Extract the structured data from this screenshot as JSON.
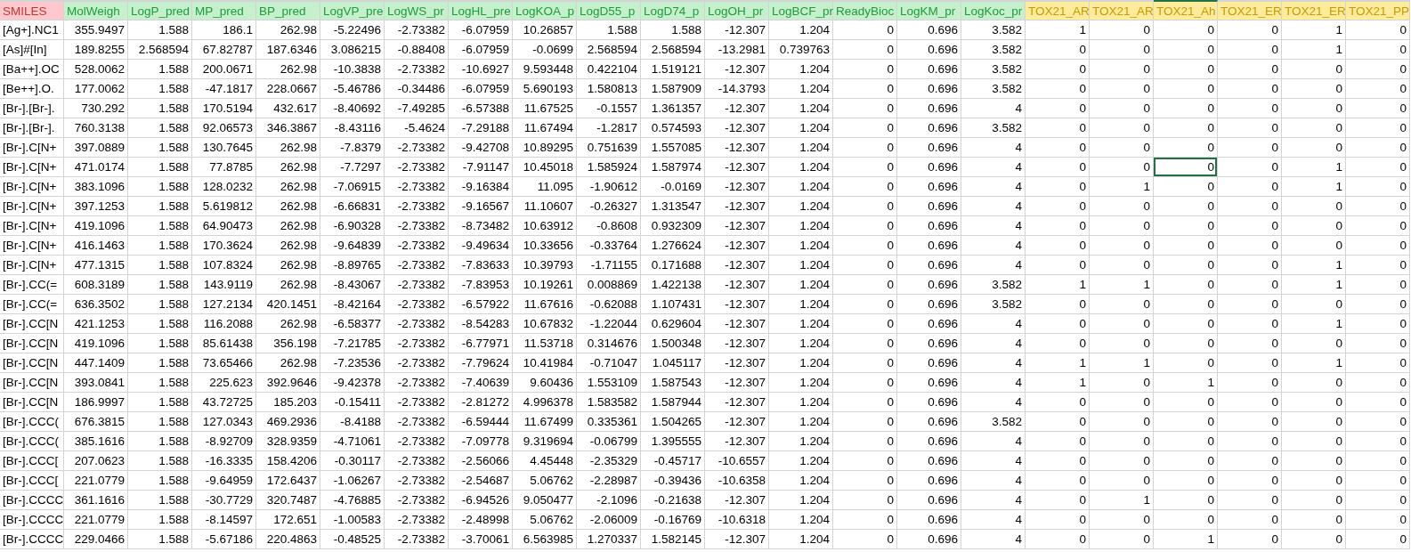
{
  "columns": [
    {
      "label": "SMILES",
      "kind": "id",
      "selected": false
    },
    {
      "label": "MolWeigh",
      "kind": "property",
      "selected": false
    },
    {
      "label": "LogP_pred",
      "kind": "property",
      "selected": false
    },
    {
      "label": "MP_pred",
      "kind": "property",
      "selected": false
    },
    {
      "label": "BP_pred",
      "kind": "property",
      "selected": false
    },
    {
      "label": "LogVP_pre",
      "kind": "property",
      "selected": false
    },
    {
      "label": "LogWS_pr",
      "kind": "property",
      "selected": false
    },
    {
      "label": "LogHL_pre",
      "kind": "property",
      "selected": false
    },
    {
      "label": "LogKOA_p",
      "kind": "property",
      "selected": false
    },
    {
      "label": "LogD55_p",
      "kind": "property",
      "selected": false
    },
    {
      "label": "LogD74_p",
      "kind": "property",
      "selected": false
    },
    {
      "label": "LogOH_pr",
      "kind": "property",
      "selected": false
    },
    {
      "label": "LogBCF_pr",
      "kind": "property",
      "selected": false
    },
    {
      "label": "ReadyBioc",
      "kind": "property",
      "selected": false
    },
    {
      "label": "LogKM_pr",
      "kind": "property",
      "selected": false
    },
    {
      "label": "LogKoc_pr",
      "kind": "property",
      "selected": false
    },
    {
      "label": "TOX21_AR",
      "kind": "tox",
      "selected": false
    },
    {
      "label": "TOX21_AR",
      "kind": "tox",
      "selected": false
    },
    {
      "label": "TOX21_Ah",
      "kind": "tox",
      "selected": true
    },
    {
      "label": "TOX21_ER",
      "kind": "tox",
      "selected": false
    },
    {
      "label": "TOX21_ER",
      "kind": "tox",
      "selected": false
    },
    {
      "label": "TOX21_PP",
      "kind": "tox",
      "selected": false
    }
  ],
  "rows": [
    {
      "values": [
        "[Ag+].NC1",
        "355.9497",
        "1.588",
        "186.1",
        "262.98",
        "-5.22496",
        "-2.73382",
        "-6.07959",
        "10.26857",
        "1.588",
        "1.588",
        "-12.307",
        "1.204",
        "0",
        "0.696",
        "3.582"
      ],
      "tox": [
        {
          "value": "1",
          "selected": false
        },
        {
          "value": "0",
          "selected": false
        },
        {
          "value": "0",
          "selected": false
        },
        {
          "value": "0",
          "selected": false
        },
        {
          "value": "1",
          "selected": false
        },
        {
          "value": "0",
          "selected": false
        }
      ]
    },
    {
      "values": [
        "[As]#[In]",
        "189.8255",
        "2.568594",
        "67.82787",
        "187.6346",
        "3.086215",
        "-0.88408",
        "-6.07959",
        "-0.0699",
        "2.568594",
        "2.568594",
        "-13.2981",
        "0.739763",
        "0",
        "0.696",
        "3.582"
      ],
      "tox": [
        {
          "value": "0",
          "selected": false
        },
        {
          "value": "0",
          "selected": false
        },
        {
          "value": "0",
          "selected": false
        },
        {
          "value": "0",
          "selected": false
        },
        {
          "value": "1",
          "selected": false
        },
        {
          "value": "0",
          "selected": false
        }
      ]
    },
    {
      "values": [
        "[Ba++].OC",
        "528.0062",
        "1.588",
        "200.0671",
        "262.98",
        "-10.3838",
        "-2.73382",
        "-10.6927",
        "9.593448",
        "0.422104",
        "1.519121",
        "-12.307",
        "1.204",
        "0",
        "0.696",
        "3.582"
      ],
      "tox": [
        {
          "value": "0",
          "selected": false
        },
        {
          "value": "0",
          "selected": false
        },
        {
          "value": "0",
          "selected": false
        },
        {
          "value": "0",
          "selected": false
        },
        {
          "value": "0",
          "selected": false
        },
        {
          "value": "0",
          "selected": false
        }
      ]
    },
    {
      "values": [
        "[Be++].O.",
        "177.0062",
        "1.588",
        "-47.1817",
        "228.0667",
        "-5.46786",
        "-0.34486",
        "-6.07959",
        "5.690193",
        "1.580813",
        "1.587909",
        "-14.3793",
        "1.204",
        "0",
        "0.696",
        "3.582"
      ],
      "tox": [
        {
          "value": "0",
          "selected": false
        },
        {
          "value": "0",
          "selected": false
        },
        {
          "value": "0",
          "selected": false
        },
        {
          "value": "0",
          "selected": false
        },
        {
          "value": "0",
          "selected": false
        },
        {
          "value": "0",
          "selected": false
        }
      ]
    },
    {
      "values": [
        "[Br-].[Br-].",
        "730.292",
        "1.588",
        "170.5194",
        "432.617",
        "-8.40692",
        "-7.49285",
        "-6.57388",
        "11.67525",
        "-0.1557",
        "1.361357",
        "-12.307",
        "1.204",
        "0",
        "0.696",
        "4"
      ],
      "tox": [
        {
          "value": "0",
          "selected": false
        },
        {
          "value": "0",
          "selected": false
        },
        {
          "value": "0",
          "selected": false
        },
        {
          "value": "0",
          "selected": false
        },
        {
          "value": "0",
          "selected": false
        },
        {
          "value": "0",
          "selected": false
        }
      ]
    },
    {
      "values": [
        "[Br-].[Br-].",
        "760.3138",
        "1.588",
        "92.06573",
        "346.3867",
        "-8.43116",
        "-5.4624",
        "-7.29188",
        "11.67494",
        "-1.2817",
        "0.574593",
        "-12.307",
        "1.204",
        "0",
        "0.696",
        "3.582"
      ],
      "tox": [
        {
          "value": "0",
          "selected": false
        },
        {
          "value": "0",
          "selected": false
        },
        {
          "value": "0",
          "selected": false
        },
        {
          "value": "0",
          "selected": false
        },
        {
          "value": "0",
          "selected": false
        },
        {
          "value": "0",
          "selected": false
        }
      ]
    },
    {
      "values": [
        "[Br-].C[N+",
        "397.0889",
        "1.588",
        "130.7645",
        "262.98",
        "-7.8379",
        "-2.73382",
        "-9.42708",
        "10.89295",
        "0.751639",
        "1.557085",
        "-12.307",
        "1.204",
        "0",
        "0.696",
        "4"
      ],
      "tox": [
        {
          "value": "0",
          "selected": false
        },
        {
          "value": "0",
          "selected": false
        },
        {
          "value": "0",
          "selected": false
        },
        {
          "value": "0",
          "selected": false
        },
        {
          "value": "0",
          "selected": false
        },
        {
          "value": "0",
          "selected": false
        }
      ]
    },
    {
      "values": [
        "[Br-].C[N+",
        "471.0174",
        "1.588",
        "77.8785",
        "262.98",
        "-7.7297",
        "-2.73382",
        "-7.91147",
        "10.45018",
        "1.585924",
        "1.587974",
        "-12.307",
        "1.204",
        "0",
        "0.696",
        "4"
      ],
      "tox": [
        {
          "value": "0",
          "selected": false
        },
        {
          "value": "0",
          "selected": false
        },
        {
          "value": "0",
          "selected": true
        },
        {
          "value": "0",
          "selected": false
        },
        {
          "value": "1",
          "selected": false
        },
        {
          "value": "0",
          "selected": false
        }
      ]
    },
    {
      "values": [
        "[Br-].C[N+",
        "383.1096",
        "1.588",
        "128.0232",
        "262.98",
        "-7.06915",
        "-2.73382",
        "-9.16384",
        "11.095",
        "-1.90612",
        "-0.0169",
        "-12.307",
        "1.204",
        "0",
        "0.696",
        "4"
      ],
      "tox": [
        {
          "value": "0",
          "selected": false
        },
        {
          "value": "1",
          "selected": false
        },
        {
          "value": "0",
          "selected": false
        },
        {
          "value": "0",
          "selected": false
        },
        {
          "value": "1",
          "selected": false
        },
        {
          "value": "0",
          "selected": false
        }
      ]
    },
    {
      "values": [
        "[Br-].C[N+",
        "397.1253",
        "1.588",
        "5.619812",
        "262.98",
        "-6.66831",
        "-2.73382",
        "-9.16567",
        "11.10607",
        "-0.26327",
        "1.313547",
        "-12.307",
        "1.204",
        "0",
        "0.696",
        "4"
      ],
      "tox": [
        {
          "value": "0",
          "selected": false
        },
        {
          "value": "0",
          "selected": false
        },
        {
          "value": "0",
          "selected": false
        },
        {
          "value": "0",
          "selected": false
        },
        {
          "value": "0",
          "selected": false
        },
        {
          "value": "0",
          "selected": false
        }
      ]
    },
    {
      "values": [
        "[Br-].C[N+",
        "419.1096",
        "1.588",
        "64.90473",
        "262.98",
        "-6.90328",
        "-2.73382",
        "-8.73482",
        "10.63912",
        "-0.8608",
        "0.932309",
        "-12.307",
        "1.204",
        "0",
        "0.696",
        "4"
      ],
      "tox": [
        {
          "value": "0",
          "selected": false
        },
        {
          "value": "0",
          "selected": false
        },
        {
          "value": "0",
          "selected": false
        },
        {
          "value": "0",
          "selected": false
        },
        {
          "value": "0",
          "selected": false
        },
        {
          "value": "0",
          "selected": false
        }
      ]
    },
    {
      "values": [
        "[Br-].C[N+",
        "416.1463",
        "1.588",
        "170.3624",
        "262.98",
        "-9.64839",
        "-2.73382",
        "-9.49634",
        "10.33656",
        "-0.33764",
        "1.276624",
        "-12.307",
        "1.204",
        "0",
        "0.696",
        "4"
      ],
      "tox": [
        {
          "value": "0",
          "selected": false
        },
        {
          "value": "0",
          "selected": false
        },
        {
          "value": "0",
          "selected": false
        },
        {
          "value": "0",
          "selected": false
        },
        {
          "value": "0",
          "selected": false
        },
        {
          "value": "0",
          "selected": false
        }
      ]
    },
    {
      "values": [
        "[Br-].C[N+",
        "477.1315",
        "1.588",
        "107.8324",
        "262.98",
        "-8.89765",
        "-2.73382",
        "-7.83633",
        "10.39793",
        "-1.71155",
        "0.171688",
        "-12.307",
        "1.204",
        "0",
        "0.696",
        "4"
      ],
      "tox": [
        {
          "value": "0",
          "selected": false
        },
        {
          "value": "0",
          "selected": false
        },
        {
          "value": "0",
          "selected": false
        },
        {
          "value": "0",
          "selected": false
        },
        {
          "value": "1",
          "selected": false
        },
        {
          "value": "0",
          "selected": false
        }
      ]
    },
    {
      "values": [
        "[Br-].CC(=",
        "608.3189",
        "1.588",
        "143.9119",
        "262.98",
        "-8.43067",
        "-2.73382",
        "-7.83953",
        "10.19261",
        "0.008869",
        "1.422138",
        "-12.307",
        "1.204",
        "0",
        "0.696",
        "3.582"
      ],
      "tox": [
        {
          "value": "1",
          "selected": false
        },
        {
          "value": "1",
          "selected": false
        },
        {
          "value": "0",
          "selected": false
        },
        {
          "value": "0",
          "selected": false
        },
        {
          "value": "1",
          "selected": false
        },
        {
          "value": "0",
          "selected": false
        }
      ]
    },
    {
      "values": [
        "[Br-].CC(=",
        "636.3502",
        "1.588",
        "127.2134",
        "420.1451",
        "-8.42164",
        "-2.73382",
        "-6.57922",
        "11.67616",
        "-0.62088",
        "1.107431",
        "-12.307",
        "1.204",
        "0",
        "0.696",
        "3.582"
      ],
      "tox": [
        {
          "value": "0",
          "selected": false
        },
        {
          "value": "0",
          "selected": false
        },
        {
          "value": "0",
          "selected": false
        },
        {
          "value": "0",
          "selected": false
        },
        {
          "value": "0",
          "selected": false
        },
        {
          "value": "0",
          "selected": false
        }
      ]
    },
    {
      "values": [
        "[Br-].CC[N",
        "421.1253",
        "1.588",
        "116.2088",
        "262.98",
        "-6.58377",
        "-2.73382",
        "-8.54283",
        "10.67832",
        "-1.22044",
        "0.629604",
        "-12.307",
        "1.204",
        "0",
        "0.696",
        "4"
      ],
      "tox": [
        {
          "value": "0",
          "selected": false
        },
        {
          "value": "0",
          "selected": false
        },
        {
          "value": "0",
          "selected": false
        },
        {
          "value": "0",
          "selected": false
        },
        {
          "value": "1",
          "selected": false
        },
        {
          "value": "0",
          "selected": false
        }
      ]
    },
    {
      "values": [
        "[Br-].CC[N",
        "419.1096",
        "1.588",
        "85.61438",
        "356.198",
        "-7.21785",
        "-2.73382",
        "-6.77971",
        "11.53718",
        "0.314676",
        "1.500348",
        "-12.307",
        "1.204",
        "0",
        "0.696",
        "4"
      ],
      "tox": [
        {
          "value": "0",
          "selected": false
        },
        {
          "value": "0",
          "selected": false
        },
        {
          "value": "0",
          "selected": false
        },
        {
          "value": "0",
          "selected": false
        },
        {
          "value": "0",
          "selected": false
        },
        {
          "value": "0",
          "selected": false
        }
      ]
    },
    {
      "values": [
        "[Br-].CC[N",
        "447.1409",
        "1.588",
        "73.65466",
        "262.98",
        "-7.23536",
        "-2.73382",
        "-7.79624",
        "10.41984",
        "-0.71047",
        "1.045117",
        "-12.307",
        "1.204",
        "0",
        "0.696",
        "4"
      ],
      "tox": [
        {
          "value": "1",
          "selected": false
        },
        {
          "value": "1",
          "selected": false
        },
        {
          "value": "0",
          "selected": false
        },
        {
          "value": "0",
          "selected": false
        },
        {
          "value": "1",
          "selected": false
        },
        {
          "value": "0",
          "selected": false
        }
      ]
    },
    {
      "values": [
        "[Br-].CC[N",
        "393.0841",
        "1.588",
        "225.623",
        "392.9646",
        "-9.42378",
        "-2.73382",
        "-7.40639",
        "9.60436",
        "1.553109",
        "1.587543",
        "-12.307",
        "1.204",
        "0",
        "0.696",
        "4"
      ],
      "tox": [
        {
          "value": "1",
          "selected": false
        },
        {
          "value": "0",
          "selected": false
        },
        {
          "value": "1",
          "selected": false
        },
        {
          "value": "0",
          "selected": false
        },
        {
          "value": "0",
          "selected": false
        },
        {
          "value": "0",
          "selected": false
        }
      ]
    },
    {
      "values": [
        "[Br-].CC[N",
        "186.9997",
        "1.588",
        "43.72725",
        "185.203",
        "-0.15411",
        "-2.73382",
        "-2.81272",
        "4.996378",
        "1.583582",
        "1.587944",
        "-12.307",
        "1.204",
        "0",
        "0.696",
        "4"
      ],
      "tox": [
        {
          "value": "0",
          "selected": false
        },
        {
          "value": "0",
          "selected": false
        },
        {
          "value": "0",
          "selected": false
        },
        {
          "value": "0",
          "selected": false
        },
        {
          "value": "0",
          "selected": false
        },
        {
          "value": "0",
          "selected": false
        }
      ]
    },
    {
      "values": [
        "[Br-].CCC(",
        "676.3815",
        "1.588",
        "127.0343",
        "469.2936",
        "-8.4188",
        "-2.73382",
        "-6.59444",
        "11.67499",
        "0.335361",
        "1.504265",
        "-12.307",
        "1.204",
        "0",
        "0.696",
        "3.582"
      ],
      "tox": [
        {
          "value": "0",
          "selected": false
        },
        {
          "value": "0",
          "selected": false
        },
        {
          "value": "0",
          "selected": false
        },
        {
          "value": "0",
          "selected": false
        },
        {
          "value": "0",
          "selected": false
        },
        {
          "value": "0",
          "selected": false
        }
      ]
    },
    {
      "values": [
        "[Br-].CCC(",
        "385.1616",
        "1.588",
        "-8.92709",
        "328.9359",
        "-4.71061",
        "-2.73382",
        "-7.09778",
        "9.319694",
        "-0.06799",
        "1.395555",
        "-12.307",
        "1.204",
        "0",
        "0.696",
        "4"
      ],
      "tox": [
        {
          "value": "0",
          "selected": false
        },
        {
          "value": "0",
          "selected": false
        },
        {
          "value": "0",
          "selected": false
        },
        {
          "value": "0",
          "selected": false
        },
        {
          "value": "0",
          "selected": false
        },
        {
          "value": "0",
          "selected": false
        }
      ]
    },
    {
      "values": [
        "[Br-].CCC[",
        "207.0623",
        "1.588",
        "-16.3335",
        "158.4206",
        "-0.30117",
        "-2.73382",
        "-2.56066",
        "4.45448",
        "-2.35329",
        "-0.45717",
        "-10.6557",
        "1.204",
        "0",
        "0.696",
        "4"
      ],
      "tox": [
        {
          "value": "0",
          "selected": false
        },
        {
          "value": "0",
          "selected": false
        },
        {
          "value": "0",
          "selected": false
        },
        {
          "value": "0",
          "selected": false
        },
        {
          "value": "0",
          "selected": false
        },
        {
          "value": "0",
          "selected": false
        }
      ]
    },
    {
      "values": [
        "[Br-].CCC[",
        "221.0779",
        "1.588",
        "-9.64959",
        "172.6437",
        "-1.06267",
        "-2.73382",
        "-2.54687",
        "5.06762",
        "-2.28987",
        "-0.39436",
        "-10.6358",
        "1.204",
        "0",
        "0.696",
        "4"
      ],
      "tox": [
        {
          "value": "0",
          "selected": false
        },
        {
          "value": "0",
          "selected": false
        },
        {
          "value": "0",
          "selected": false
        },
        {
          "value": "0",
          "selected": false
        },
        {
          "value": "0",
          "selected": false
        },
        {
          "value": "0",
          "selected": false
        }
      ]
    },
    {
      "values": [
        "[Br-].CCCC",
        "361.1616",
        "1.588",
        "-30.7729",
        "320.7487",
        "-4.76885",
        "-2.73382",
        "-6.94526",
        "9.050477",
        "-2.1096",
        "-0.21638",
        "-12.307",
        "1.204",
        "0",
        "0.696",
        "4"
      ],
      "tox": [
        {
          "value": "0",
          "selected": false
        },
        {
          "value": "1",
          "selected": false
        },
        {
          "value": "0",
          "selected": false
        },
        {
          "value": "0",
          "selected": false
        },
        {
          "value": "0",
          "selected": false
        },
        {
          "value": "0",
          "selected": false
        }
      ]
    },
    {
      "values": [
        "[Br-].CCCC",
        "221.0779",
        "1.588",
        "-8.14597",
        "172.651",
        "-1.00583",
        "-2.73382",
        "-2.48998",
        "5.06762",
        "-2.06009",
        "-0.16769",
        "-10.6318",
        "1.204",
        "0",
        "0.696",
        "4"
      ],
      "tox": [
        {
          "value": "0",
          "selected": false
        },
        {
          "value": "0",
          "selected": false
        },
        {
          "value": "0",
          "selected": false
        },
        {
          "value": "0",
          "selected": false
        },
        {
          "value": "0",
          "selected": false
        },
        {
          "value": "0",
          "selected": false
        }
      ]
    },
    {
      "values": [
        "[Br-].CCCC",
        "229.0466",
        "1.588",
        "-5.67186",
        "220.4863",
        "-0.48525",
        "-2.73382",
        "-3.70061",
        "6.563985",
        "1.270337",
        "1.582145",
        "-12.307",
        "1.204",
        "0",
        "0.696",
        "4"
      ],
      "tox": [
        {
          "value": "0",
          "selected": false
        },
        {
          "value": "0",
          "selected": false
        },
        {
          "value": "1",
          "selected": false
        },
        {
          "value": "0",
          "selected": false
        },
        {
          "value": "0",
          "selected": false
        },
        {
          "value": "0",
          "selected": false
        }
      ]
    }
  ]
}
